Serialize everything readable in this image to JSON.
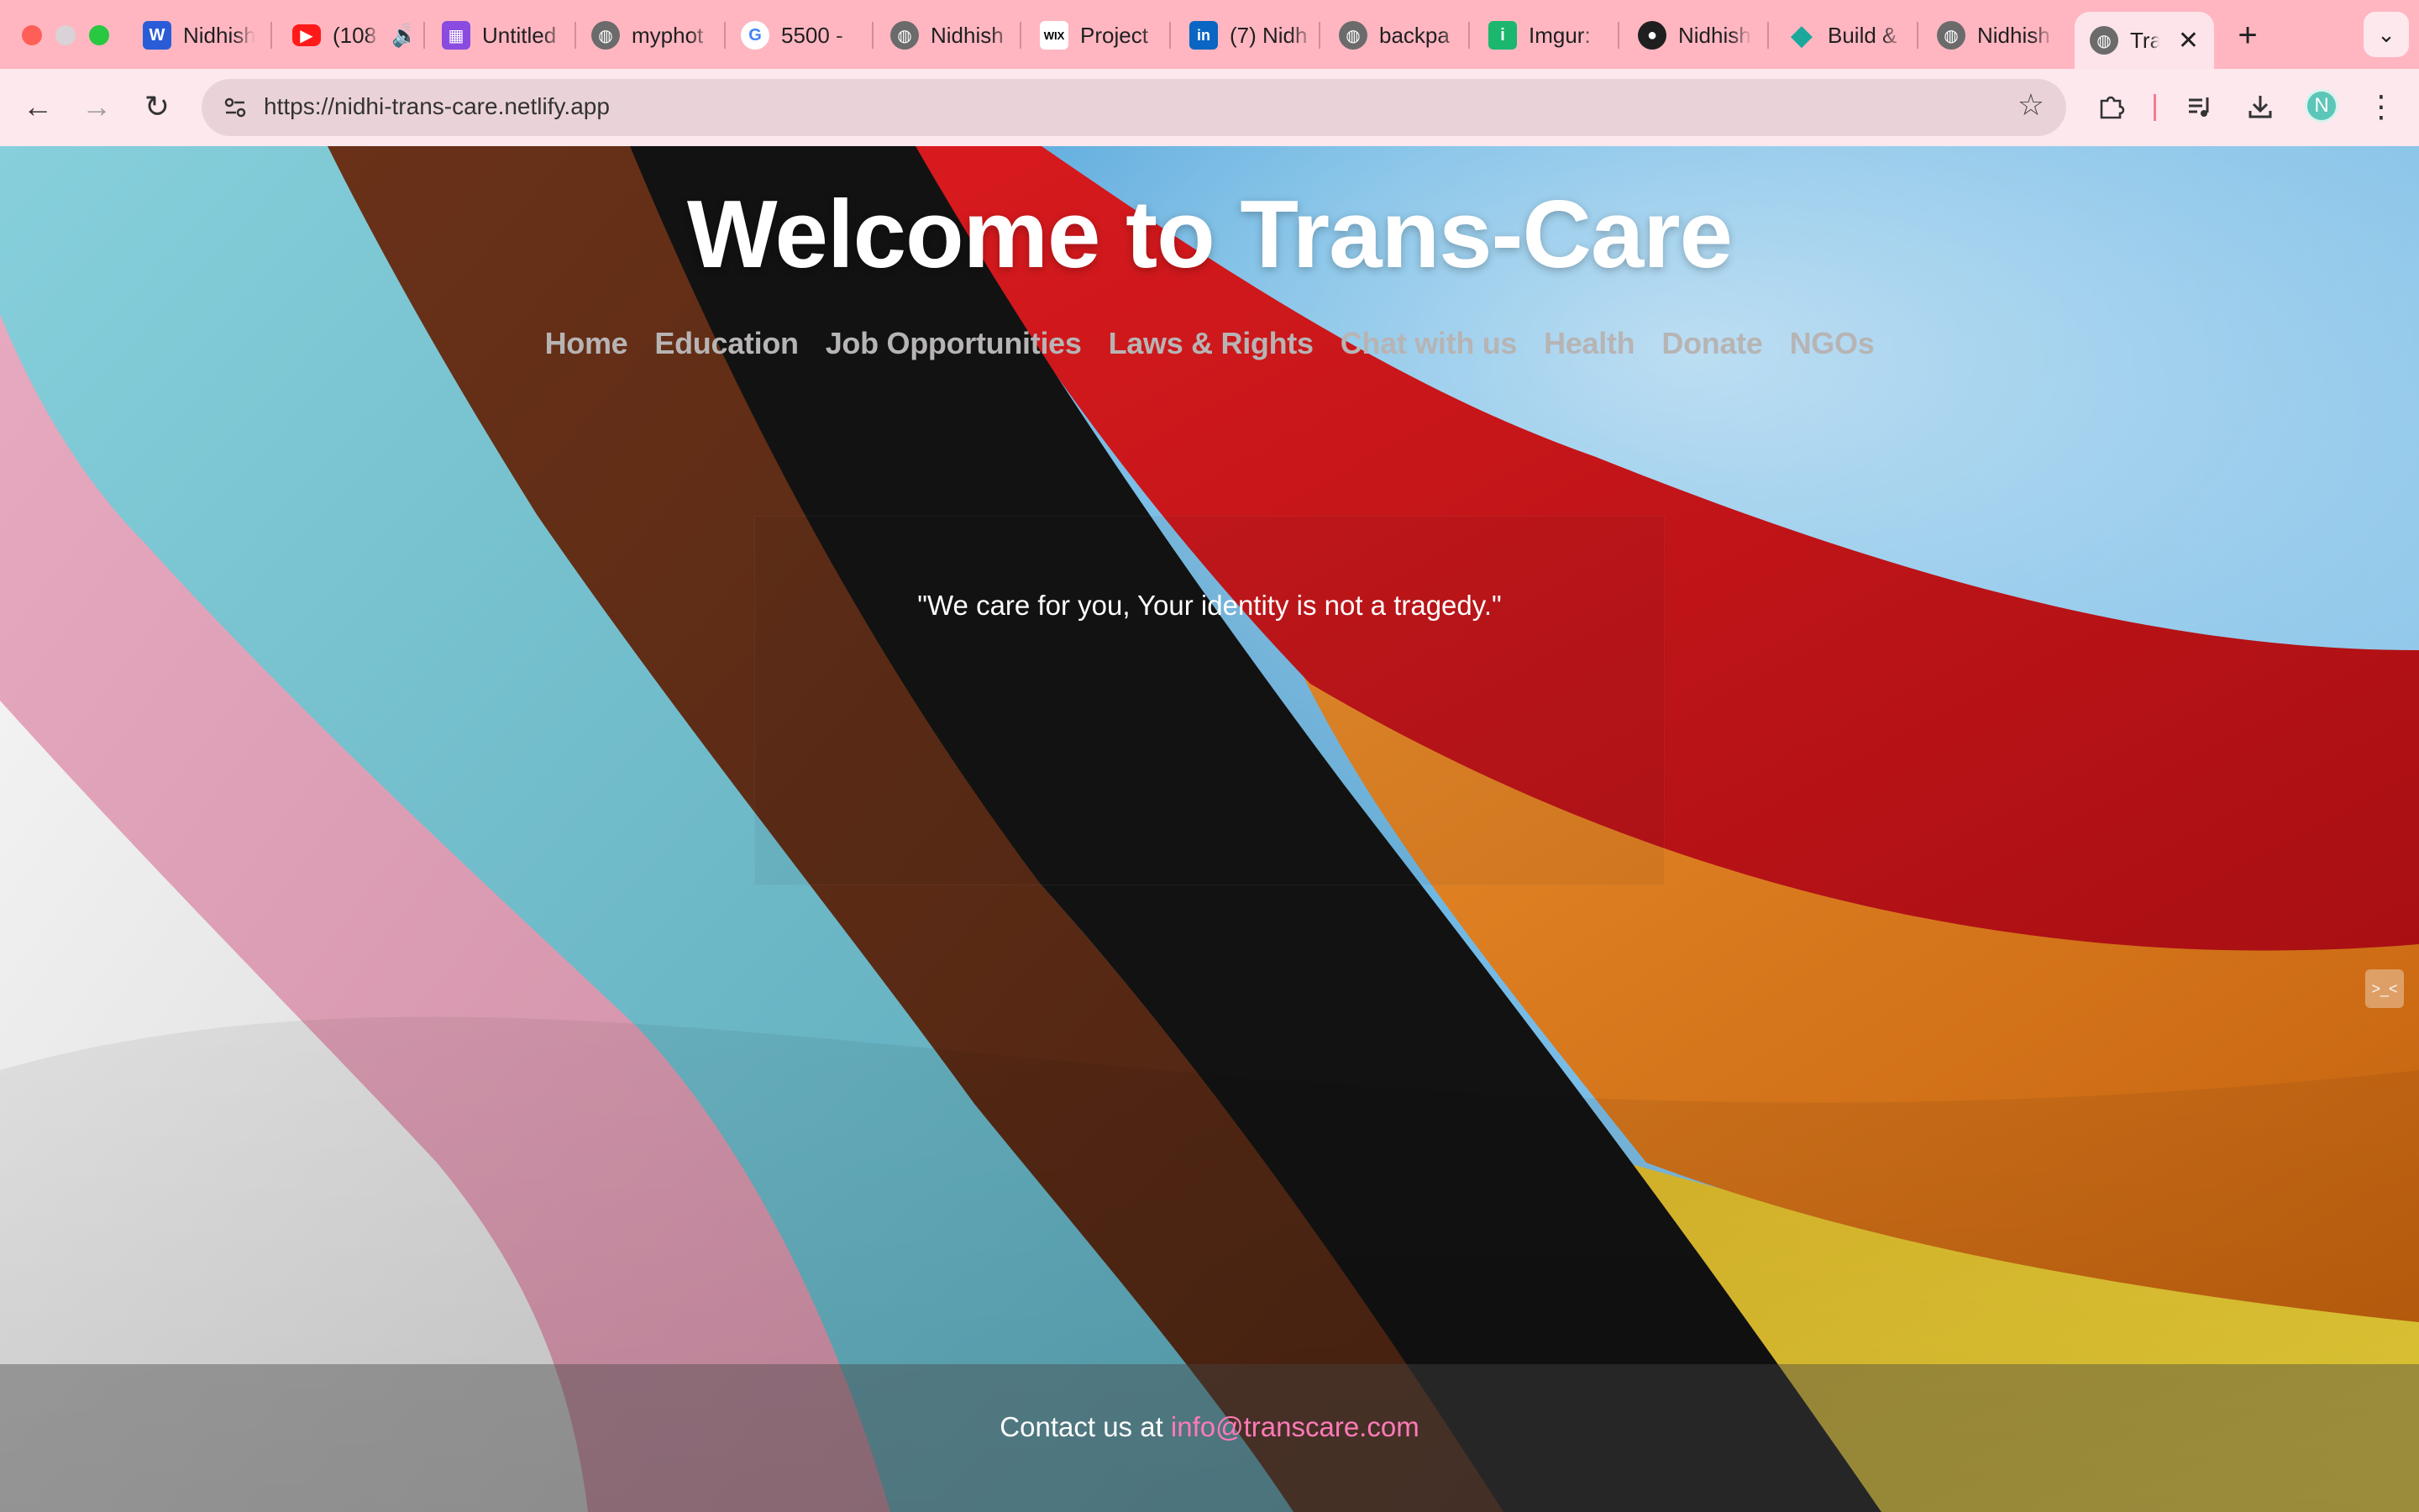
{
  "browser": {
    "tabs": [
      {
        "title": "Nidhish",
        "icon": "word-icon"
      },
      {
        "title": "(108",
        "icon": "youtube-icon"
      },
      {
        "title": "Untitled",
        "icon": "app-icon"
      },
      {
        "title": "myphot",
        "icon": "globe-icon"
      },
      {
        "title": "5500 -",
        "icon": "google-icon"
      },
      {
        "title": "Nidhish",
        "icon": "globe-icon"
      },
      {
        "title": "Project",
        "icon": "wix-icon"
      },
      {
        "title": "(7) Nidh",
        "icon": "linkedin-icon"
      },
      {
        "title": "backpa",
        "icon": "globe-icon"
      },
      {
        "title": "Imgur:",
        "icon": "imgur-icon"
      },
      {
        "title": "Nidhish",
        "icon": "github-icon"
      },
      {
        "title": "Build &",
        "icon": "diamond-icon"
      },
      {
        "title": "Nidhish",
        "icon": "globe-icon"
      }
    ],
    "active_tab": {
      "title": "Tra",
      "icon": "globe-icon"
    },
    "url": "https://nidhi-trans-care.netlify.app",
    "profile_initial": "N",
    "chrome_color": "#ffb6c1"
  },
  "hero": {
    "title": "Welcome to Trans-Care"
  },
  "nav": {
    "items": [
      "Home",
      "Education",
      "Job Opportunities",
      "Laws & Rights",
      "Chat with us",
      "Health",
      "Donate",
      "NGOs"
    ]
  },
  "quote": {
    "text": "\"We care for you, Your identity is not a tragedy.\""
  },
  "footer": {
    "prefix": "Contact us at ",
    "email": "info@transcare.com",
    "link_color": "#ff7ab8"
  },
  "background": {
    "description_colors": [
      "#e6e6e6",
      "#e8a7bd",
      "#7ec9d4",
      "#5a2b17",
      "#111111",
      "#e07a1c",
      "#c8151a",
      "#e6c22e",
      "#4e9ed8"
    ]
  }
}
